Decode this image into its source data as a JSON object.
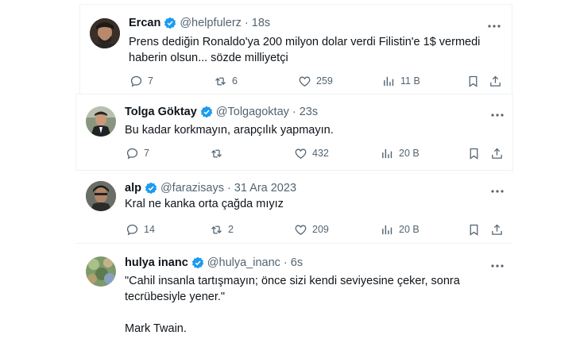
{
  "tweets": [
    {
      "name": "Ercan",
      "handle": "@helpfulerz",
      "time": "18s",
      "text_lines": [
        "Prens dediğin Ronaldo'ya 200 milyon dolar verdi Filistin'e 1$ vermedi",
        "haberin olsun... sözde milliyetçi"
      ],
      "replies": "7",
      "reposts": "6",
      "likes": "259",
      "views": "11 B",
      "avatar_color": "#4a3a30"
    },
    {
      "name": "Tolga Göktay",
      "handle": "@Tolgagoktay",
      "time": "23s",
      "text_lines": [
        "Bu kadar korkmayın, arapçılık yapmayın."
      ],
      "replies": "7",
      "reposts": "",
      "likes": "432",
      "views": "20 B",
      "avatar_color": "#6f7a68"
    },
    {
      "name": "alp",
      "handle": "@farazisays",
      "time": "31 Ara 2023",
      "text_lines": [
        "Kral ne kanka orta çağda mıyız"
      ],
      "replies": "14",
      "reposts": "2",
      "likes": "209",
      "views": "20 B",
      "avatar_color": "#3d3d3a"
    },
    {
      "name": "hulya inanc",
      "handle": "@hulya_inanc",
      "time": "6s",
      "text_lines": [
        "\"Cahil insanla tartışmayın; önce sizi kendi seviyesine çeker, sonra",
        "tecrübesiyle yener.\"",
        "",
        "Mark Twain."
      ],
      "avatar_color": "#5a7a4a"
    }
  ],
  "colors": {
    "verified": "#1d9bf0",
    "secondary_text": "#536471",
    "divider": "#eff3f4"
  }
}
